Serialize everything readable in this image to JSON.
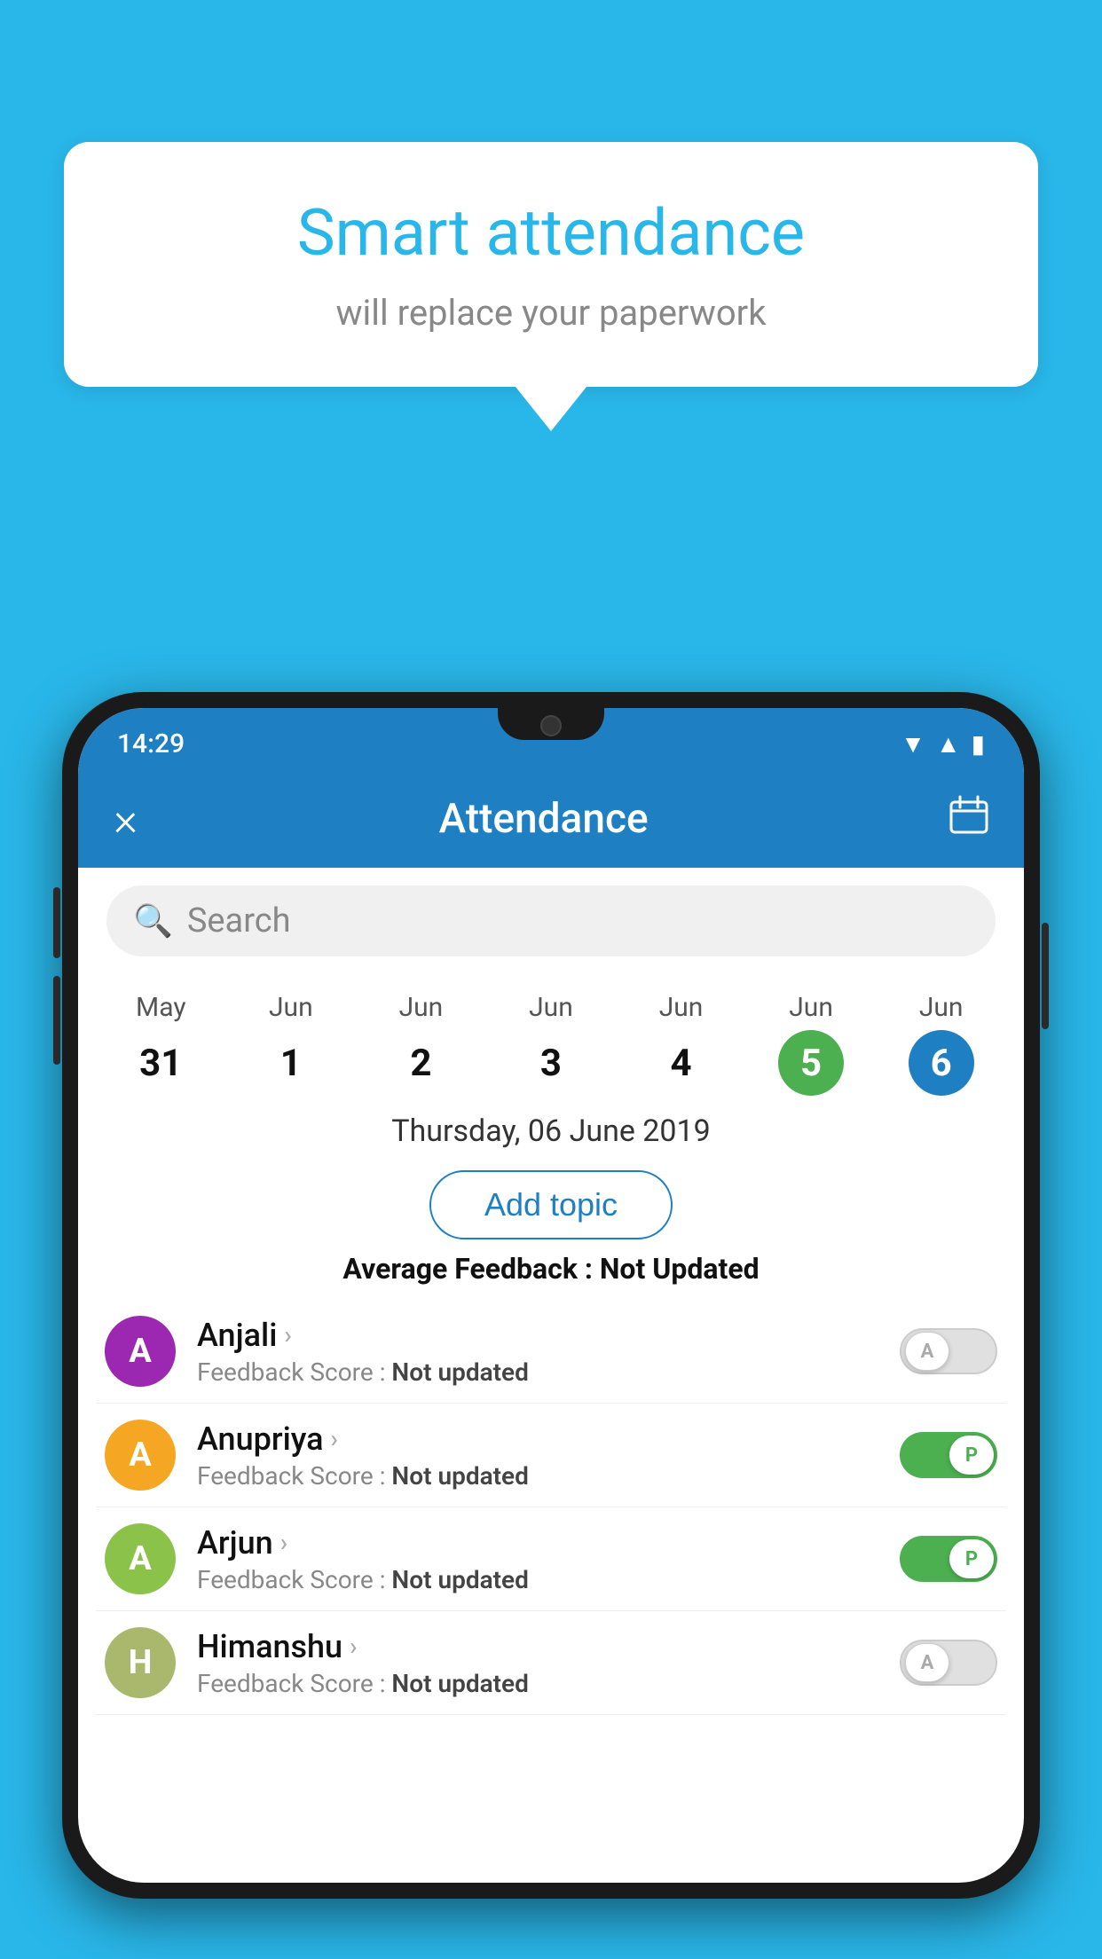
{
  "background_color": "#29b6e8",
  "speech_bubble": {
    "title": "Smart attendance",
    "subtitle": "will replace your paperwork"
  },
  "app": {
    "status_bar": {
      "time": "14:29"
    },
    "header": {
      "title": "Attendance",
      "close_label": "×",
      "calendar_icon": "📅"
    },
    "search": {
      "placeholder": "Search"
    },
    "calendar": {
      "days": [
        {
          "month": "May",
          "date": "31",
          "state": "normal"
        },
        {
          "month": "Jun",
          "date": "1",
          "state": "normal"
        },
        {
          "month": "Jun",
          "date": "2",
          "state": "normal"
        },
        {
          "month": "Jun",
          "date": "3",
          "state": "normal"
        },
        {
          "month": "Jun",
          "date": "4",
          "state": "normal"
        },
        {
          "month": "Jun",
          "date": "5",
          "state": "today"
        },
        {
          "month": "Jun",
          "date": "6",
          "state": "selected"
        }
      ]
    },
    "selected_date_label": "Thursday, 06 June 2019",
    "add_topic_label": "Add topic",
    "avg_feedback_label": "Average Feedback :",
    "avg_feedback_value": "Not Updated",
    "students": [
      {
        "name": "Anjali",
        "avatar_letter": "A",
        "avatar_color": "#9c27b0",
        "feedback_label": "Feedback Score :",
        "feedback_value": "Not updated",
        "toggle_state": "off",
        "toggle_letter": "A"
      },
      {
        "name": "Anupriya",
        "avatar_letter": "A",
        "avatar_color": "#f5a623",
        "feedback_label": "Feedback Score :",
        "feedback_value": "Not updated",
        "toggle_state": "on",
        "toggle_letter": "P"
      },
      {
        "name": "Arjun",
        "avatar_letter": "A",
        "avatar_color": "#8bc34a",
        "feedback_label": "Feedback Score :",
        "feedback_value": "Not updated",
        "toggle_state": "on",
        "toggle_letter": "P"
      },
      {
        "name": "Himanshu",
        "avatar_letter": "H",
        "avatar_color": "#aab86d",
        "feedback_label": "Feedback Score :",
        "feedback_value": "Not updated",
        "toggle_state": "off",
        "toggle_letter": "A"
      }
    ]
  }
}
